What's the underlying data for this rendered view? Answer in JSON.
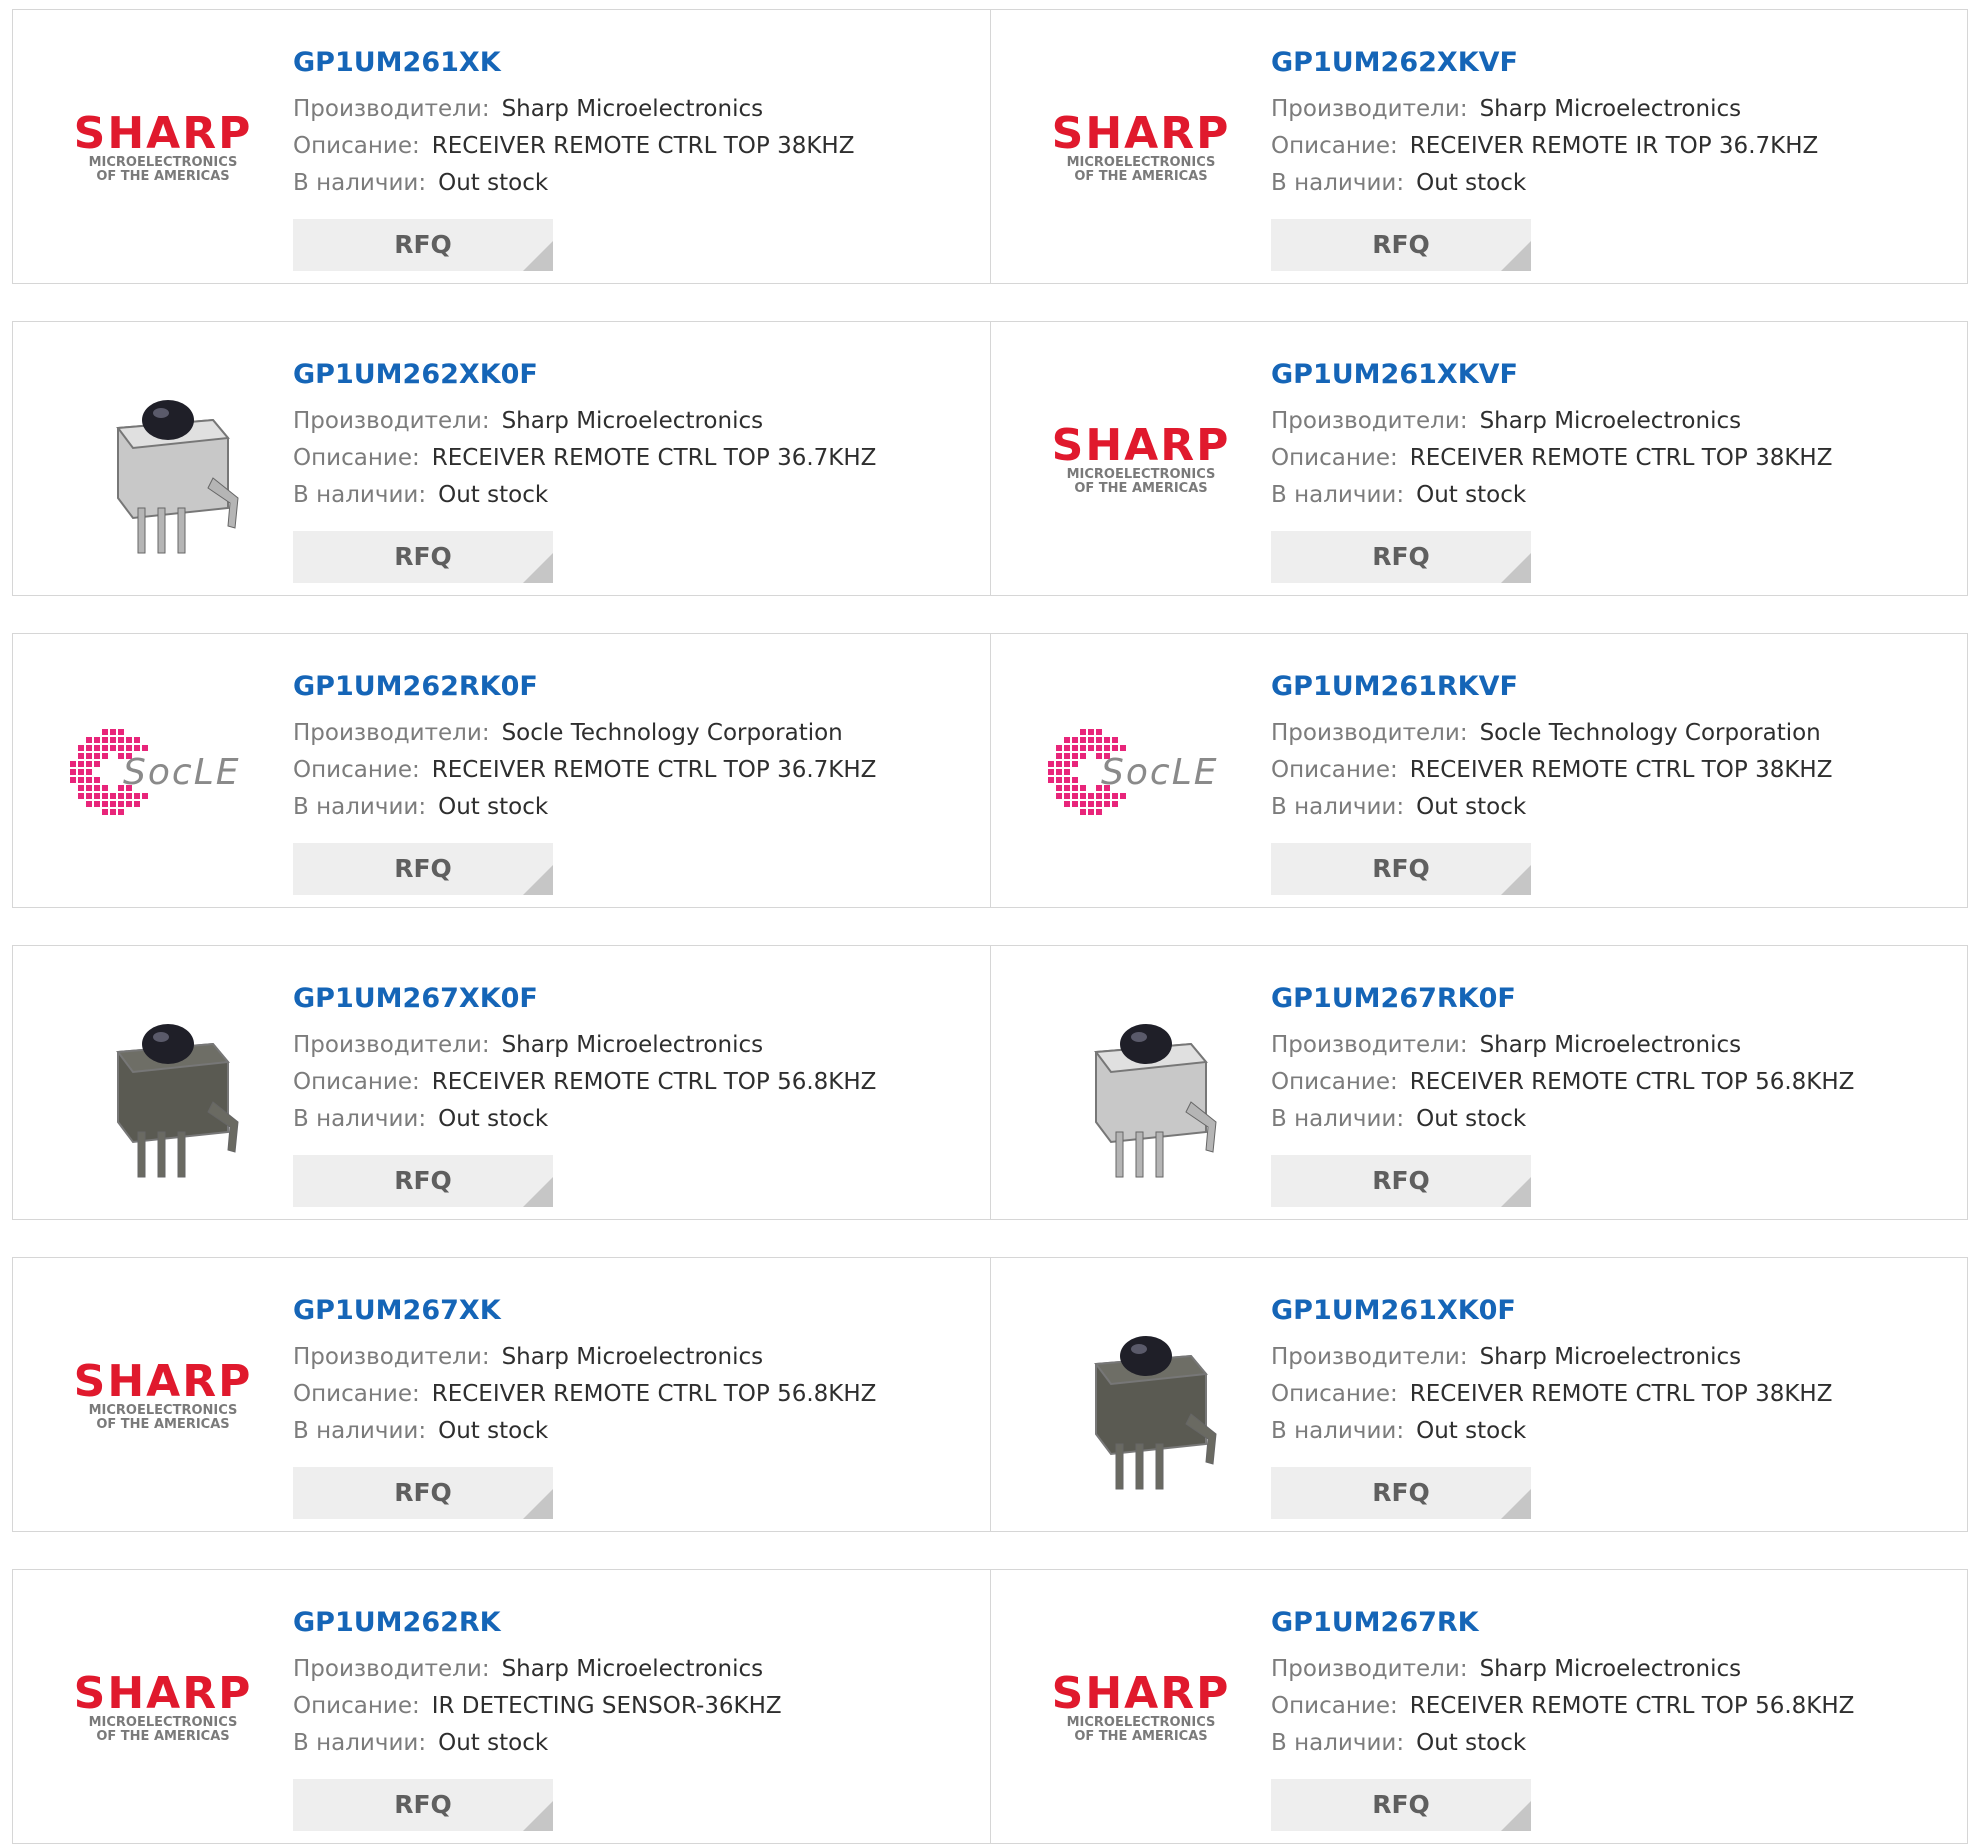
{
  "colors": {
    "link": "#1565b7",
    "sharp_red": "#e0192d",
    "socle_pink": "#e8257a",
    "rfq_bg": "#eeeeee"
  },
  "cards": [
    {
      "part": "GP1UM261XK",
      "manufacturer_label": "Производители:",
      "manufacturer": "Sharp Microelectronics",
      "description_label": "Описание:",
      "description": "RECEIVER REMOTE CTRL TOP 38KHZ",
      "stock_label": "В наличии:",
      "stock": "Out stock",
      "rfq": "RFQ",
      "image": "sharp-logo",
      "logo_word": "SHARP",
      "logo_sub1": "MICROELECTRONICS",
      "logo_sub2": "OF THE AMERICAS"
    },
    {
      "part": "GP1UM262XKVF",
      "manufacturer_label": "Производители:",
      "manufacturer": "Sharp Microelectronics",
      "description_label": "Описание:",
      "description": "RECEIVER REMOTE IR TOP 36.7KHZ",
      "stock_label": "В наличии:",
      "stock": "Out stock",
      "rfq": "RFQ",
      "image": "sharp-logo",
      "logo_word": "SHARP",
      "logo_sub1": "MICROELECTRONICS",
      "logo_sub2": "OF THE AMERICAS"
    },
    {
      "part": "GP1UM262XK0F",
      "manufacturer_label": "Производители:",
      "manufacturer": "Sharp Microelectronics",
      "description_label": "Описание:",
      "description": "RECEIVER REMOTE CTRL TOP 36.7KHZ",
      "stock_label": "В наличии:",
      "stock": "Out stock",
      "rfq": "RFQ",
      "image": "ir-sensor-silver"
    },
    {
      "part": "GP1UM261XKVF",
      "manufacturer_label": "Производители:",
      "manufacturer": "Sharp Microelectronics",
      "description_label": "Описание:",
      "description": "RECEIVER REMOTE CTRL TOP 38KHZ",
      "stock_label": "В наличии:",
      "stock": "Out stock",
      "rfq": "RFQ",
      "image": "sharp-logo",
      "logo_word": "SHARP",
      "logo_sub1": "MICROELECTRONICS",
      "logo_sub2": "OF THE AMERICAS"
    },
    {
      "part": "GP1UM262RK0F",
      "manufacturer_label": "Производители:",
      "manufacturer": "Socle Technology Corporation",
      "description_label": "Описание:",
      "description": "RECEIVER REMOTE CTRL TOP 36.7KHZ",
      "stock_label": "В наличии:",
      "stock": "Out stock",
      "rfq": "RFQ",
      "image": "socle-logo",
      "logo_word": "SOCLE"
    },
    {
      "part": "GP1UM261RKVF",
      "manufacturer_label": "Производители:",
      "manufacturer": "Socle Technology Corporation",
      "description_label": "Описание:",
      "description": "RECEIVER REMOTE CTRL TOP 38KHZ",
      "stock_label": "В наличии:",
      "stock": "Out stock",
      "rfq": "RFQ",
      "image": "socle-logo",
      "logo_word": "SOCLE"
    },
    {
      "part": "GP1UM267XK0F",
      "manufacturer_label": "Производители:",
      "manufacturer": "Sharp Microelectronics",
      "description_label": "Описание:",
      "description": "RECEIVER REMOTE CTRL TOP 56.8KHZ",
      "stock_label": "В наличии:",
      "stock": "Out stock",
      "rfq": "RFQ",
      "image": "ir-sensor-dark"
    },
    {
      "part": "GP1UM267RK0F",
      "manufacturer_label": "Производители:",
      "manufacturer": "Sharp Microelectronics",
      "description_label": "Описание:",
      "description": "RECEIVER REMOTE CTRL TOP 56.8KHZ",
      "stock_label": "В наличии:",
      "stock": "Out stock",
      "rfq": "RFQ",
      "image": "ir-sensor-silver"
    },
    {
      "part": "GP1UM267XK",
      "manufacturer_label": "Производители:",
      "manufacturer": "Sharp Microelectronics",
      "description_label": "Описание:",
      "description": "RECEIVER REMOTE CTRL TOP 56.8KHZ",
      "stock_label": "В наличии:",
      "stock": "Out stock",
      "rfq": "RFQ",
      "image": "sharp-logo",
      "logo_word": "SHARP",
      "logo_sub1": "MICROELECTRONICS",
      "logo_sub2": "OF THE AMERICAS"
    },
    {
      "part": "GP1UM261XK0F",
      "manufacturer_label": "Производители:",
      "manufacturer": "Sharp Microelectronics",
      "description_label": "Описание:",
      "description": "RECEIVER REMOTE CTRL TOP 38KHZ",
      "stock_label": "В наличии:",
      "stock": "Out stock",
      "rfq": "RFQ",
      "image": "ir-sensor-dark"
    },
    {
      "part": "GP1UM262RK",
      "manufacturer_label": "Производители:",
      "manufacturer": "Sharp Microelectronics",
      "description_label": "Описание:",
      "description": "IR DETECTING SENSOR-36KHZ",
      "stock_label": "В наличии:",
      "stock": "Out stock",
      "rfq": "RFQ",
      "image": "sharp-logo",
      "logo_word": "SHARP",
      "logo_sub1": "MICROELECTRONICS",
      "logo_sub2": "OF THE AMERICAS"
    },
    {
      "part": "GP1UM267RK",
      "manufacturer_label": "Производители:",
      "manufacturer": "Sharp Microelectronics",
      "description_label": "Описание:",
      "description": "RECEIVER REMOTE CTRL TOP 56.8KHZ",
      "stock_label": "В наличии:",
      "stock": "Out stock",
      "rfq": "RFQ",
      "image": "sharp-logo",
      "logo_word": "SHARP",
      "logo_sub1": "MICROELECTRONICS",
      "logo_sub2": "OF THE AMERICAS"
    }
  ]
}
